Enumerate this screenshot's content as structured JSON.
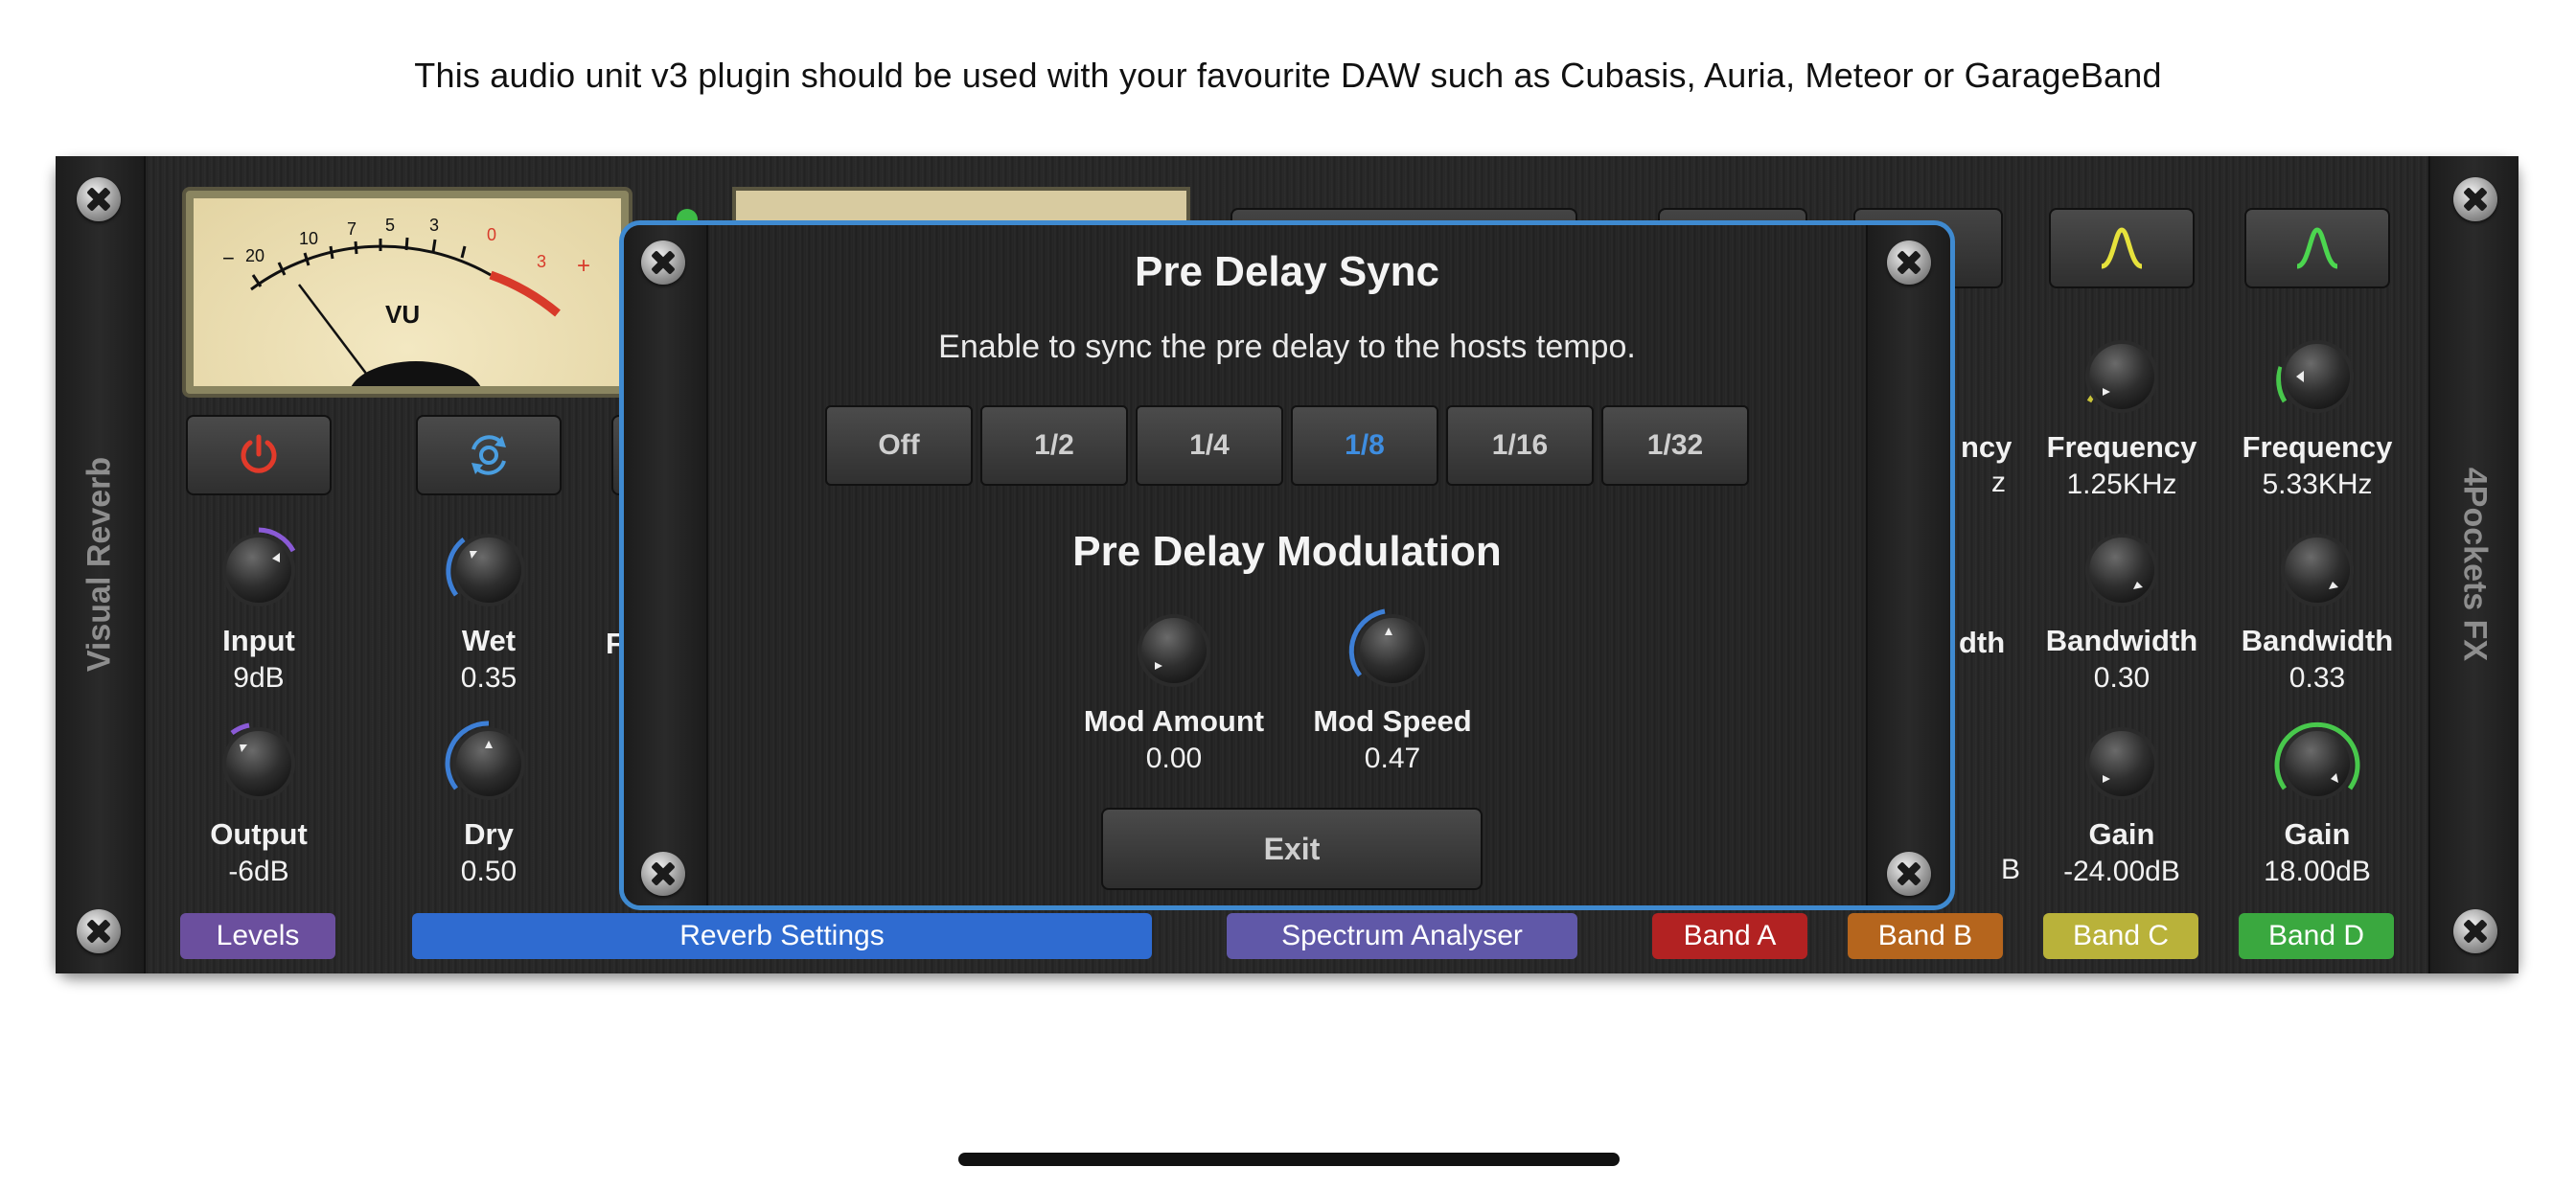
{
  "banner": "This audio unit v3 plugin should be used with your favourite DAW such as Cubasis, Auria, Meteor or GarageBand",
  "plugin": {
    "left_label": "Visual Reverb",
    "right_label": "4Pockets FX"
  },
  "vu": {
    "label": "VU",
    "scale": [
      "20",
      "10",
      "7",
      "5",
      "3",
      "0",
      "3"
    ],
    "minus": "−",
    "plus": "+"
  },
  "levels": {
    "input": {
      "label": "Input",
      "value": "9dB"
    },
    "output": {
      "label": "Output",
      "value": "-6dB"
    },
    "wet": {
      "label": "Wet",
      "value": "0.35"
    },
    "dry": {
      "label": "Dry",
      "value": "0.50"
    },
    "partial_label": "F"
  },
  "bands": {
    "b": {
      "freq_label_partial": "ncy",
      "freq_value_partial": "z",
      "bw_label_partial": "dth",
      "gain_value_partial": "B"
    },
    "c": {
      "freq_label": "Frequency",
      "freq_value": "1.25KHz",
      "bw_label": "Bandwidth",
      "bw_value": "0.30",
      "gain_label": "Gain",
      "gain_value": "-24.00dB"
    },
    "d": {
      "freq_label": "Frequency",
      "freq_value": "5.33KHz",
      "bw_label": "Bandwidth",
      "bw_value": "0.33",
      "gain_label": "Gain",
      "gain_value": "18.00dB"
    }
  },
  "tags": {
    "levels": "Levels",
    "reverb": "Reverb Settings",
    "spectrum": "Spectrum Analyser",
    "band_a": "Band A",
    "band_b": "Band B",
    "band_c": "Band C",
    "band_d": "Band D"
  },
  "colors": {
    "levels": "#6b4f9e",
    "reverb": "#2f6bd0",
    "spectrum": "#6058a8",
    "band_a": "#b22222",
    "band_b": "#b5651d",
    "band_c": "#b9b23a",
    "band_d": "#3aa83f",
    "accent": "#3e8de0"
  },
  "icons": {
    "power": "power-icon",
    "sync": "sync-icon",
    "bell_c": "bell-filter-icon",
    "bell_d": "bell-filter-icon"
  },
  "modal": {
    "sync_title": "Pre Delay Sync",
    "sync_desc": "Enable to sync the pre delay to the hosts tempo.",
    "sync_options": [
      "Off",
      "1/2",
      "1/4",
      "1/8",
      "1/16",
      "1/32"
    ],
    "sync_selected": "1/8",
    "mod_title": "Pre Delay Modulation",
    "mod_amount": {
      "label": "Mod Amount",
      "value": "0.00"
    },
    "mod_speed": {
      "label": "Mod Speed",
      "value": "0.47"
    },
    "exit": "Exit"
  }
}
